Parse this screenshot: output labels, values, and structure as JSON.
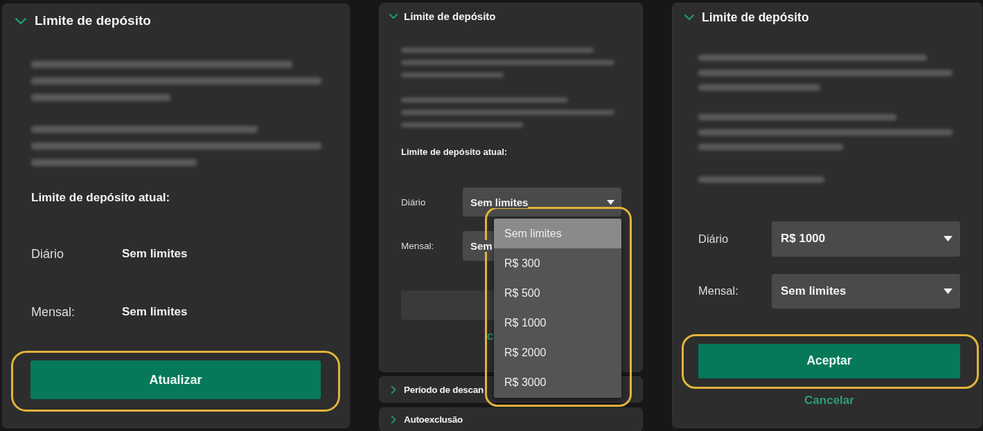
{
  "columns": [
    {
      "sections": [
        {
          "title": "Limite de depósito",
          "expanded": true,
          "body": {
            "intro_blurred": true,
            "current_heading": {
              "text": "Limite de depósito atual:",
              "blurred": false
            },
            "limits": [
              {
                "kind": "text",
                "label": "Diário",
                "value": "Sem limites"
              },
              {
                "kind": "text",
                "label": "Mensal:",
                "value": "Sem limites"
              }
            ],
            "button": {
              "label": "Atualizar",
              "disabled": false,
              "highlighted": true
            }
          }
        }
      ]
    },
    {
      "sections": [
        {
          "title": "Limite de depósito",
          "expanded": true,
          "body": {
            "intro_blurred": true,
            "current_heading": {
              "text": "Limite de depósito atual:",
              "blurred": false
            },
            "limits": [
              {
                "kind": "select",
                "label": "Diário",
                "value": "Sem limites",
                "open": true,
                "menu": {
                  "highlighted": true,
                  "options": [
                    {
                      "label": "Sem limites",
                      "selected": true
                    },
                    {
                      "label": "R$ 300",
                      "selected": false
                    },
                    {
                      "label": "R$ 500",
                      "selected": false
                    },
                    {
                      "label": "R$ 1000",
                      "selected": false
                    },
                    {
                      "label": "R$ 2000",
                      "selected": false
                    },
                    {
                      "label": "R$ 3000",
                      "selected": false
                    }
                  ]
                }
              },
              {
                "kind": "select",
                "label": "Mensal:",
                "value": "Sem",
                "open": false
              }
            ],
            "button": {
              "disabled": true,
              "highlighted": false
            },
            "cancel_link": "C"
          }
        },
        {
          "title": "Período de descan",
          "expanded": false
        },
        {
          "title": "Autoexclusão",
          "expanded": false
        }
      ]
    },
    {
      "sections": [
        {
          "title": "Limite de depósito",
          "expanded": true,
          "body": {
            "intro_blurred": true,
            "current_heading": {
              "blurred": true
            },
            "limits": [
              {
                "kind": "select",
                "label": "Diário",
                "value": "R$ 1000",
                "open": false
              },
              {
                "kind": "select",
                "label": "Mensal:",
                "value": "Sem limites",
                "open": false
              }
            ],
            "button": {
              "label": "Aceptar",
              "disabled": false,
              "highlighted": true
            },
            "cancel_link": "Cancelar"
          }
        }
      ]
    }
  ]
}
